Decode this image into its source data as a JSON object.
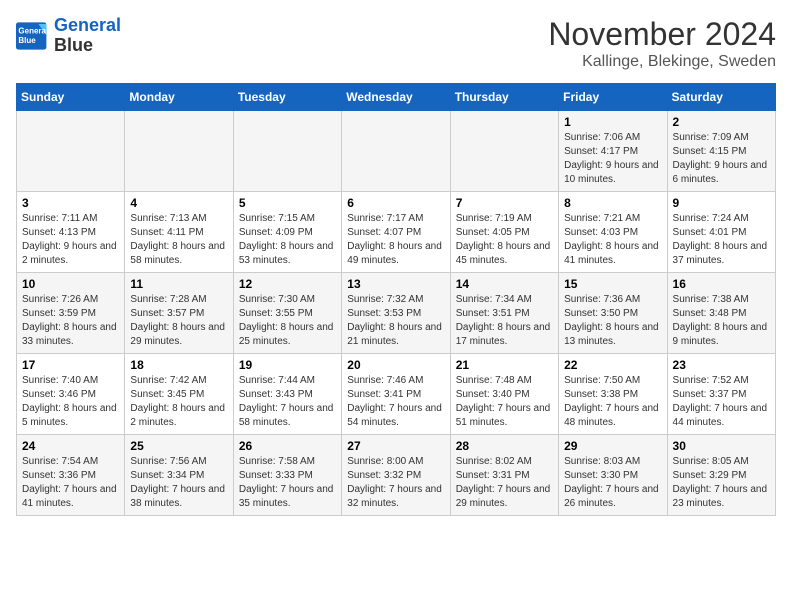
{
  "header": {
    "logo_line1": "General",
    "logo_line2": "Blue",
    "month": "November 2024",
    "location": "Kallinge, Blekinge, Sweden"
  },
  "weekdays": [
    "Sunday",
    "Monday",
    "Tuesday",
    "Wednesday",
    "Thursday",
    "Friday",
    "Saturday"
  ],
  "weeks": [
    [
      {
        "day": "",
        "info": ""
      },
      {
        "day": "",
        "info": ""
      },
      {
        "day": "",
        "info": ""
      },
      {
        "day": "",
        "info": ""
      },
      {
        "day": "",
        "info": ""
      },
      {
        "day": "1",
        "info": "Sunrise: 7:06 AM\nSunset: 4:17 PM\nDaylight: 9 hours and 10 minutes."
      },
      {
        "day": "2",
        "info": "Sunrise: 7:09 AM\nSunset: 4:15 PM\nDaylight: 9 hours and 6 minutes."
      }
    ],
    [
      {
        "day": "3",
        "info": "Sunrise: 7:11 AM\nSunset: 4:13 PM\nDaylight: 9 hours and 2 minutes."
      },
      {
        "day": "4",
        "info": "Sunrise: 7:13 AM\nSunset: 4:11 PM\nDaylight: 8 hours and 58 minutes."
      },
      {
        "day": "5",
        "info": "Sunrise: 7:15 AM\nSunset: 4:09 PM\nDaylight: 8 hours and 53 minutes."
      },
      {
        "day": "6",
        "info": "Sunrise: 7:17 AM\nSunset: 4:07 PM\nDaylight: 8 hours and 49 minutes."
      },
      {
        "day": "7",
        "info": "Sunrise: 7:19 AM\nSunset: 4:05 PM\nDaylight: 8 hours and 45 minutes."
      },
      {
        "day": "8",
        "info": "Sunrise: 7:21 AM\nSunset: 4:03 PM\nDaylight: 8 hours and 41 minutes."
      },
      {
        "day": "9",
        "info": "Sunrise: 7:24 AM\nSunset: 4:01 PM\nDaylight: 8 hours and 37 minutes."
      }
    ],
    [
      {
        "day": "10",
        "info": "Sunrise: 7:26 AM\nSunset: 3:59 PM\nDaylight: 8 hours and 33 minutes."
      },
      {
        "day": "11",
        "info": "Sunrise: 7:28 AM\nSunset: 3:57 PM\nDaylight: 8 hours and 29 minutes."
      },
      {
        "day": "12",
        "info": "Sunrise: 7:30 AM\nSunset: 3:55 PM\nDaylight: 8 hours and 25 minutes."
      },
      {
        "day": "13",
        "info": "Sunrise: 7:32 AM\nSunset: 3:53 PM\nDaylight: 8 hours and 21 minutes."
      },
      {
        "day": "14",
        "info": "Sunrise: 7:34 AM\nSunset: 3:51 PM\nDaylight: 8 hours and 17 minutes."
      },
      {
        "day": "15",
        "info": "Sunrise: 7:36 AM\nSunset: 3:50 PM\nDaylight: 8 hours and 13 minutes."
      },
      {
        "day": "16",
        "info": "Sunrise: 7:38 AM\nSunset: 3:48 PM\nDaylight: 8 hours and 9 minutes."
      }
    ],
    [
      {
        "day": "17",
        "info": "Sunrise: 7:40 AM\nSunset: 3:46 PM\nDaylight: 8 hours and 5 minutes."
      },
      {
        "day": "18",
        "info": "Sunrise: 7:42 AM\nSunset: 3:45 PM\nDaylight: 8 hours and 2 minutes."
      },
      {
        "day": "19",
        "info": "Sunrise: 7:44 AM\nSunset: 3:43 PM\nDaylight: 7 hours and 58 minutes."
      },
      {
        "day": "20",
        "info": "Sunrise: 7:46 AM\nSunset: 3:41 PM\nDaylight: 7 hours and 54 minutes."
      },
      {
        "day": "21",
        "info": "Sunrise: 7:48 AM\nSunset: 3:40 PM\nDaylight: 7 hours and 51 minutes."
      },
      {
        "day": "22",
        "info": "Sunrise: 7:50 AM\nSunset: 3:38 PM\nDaylight: 7 hours and 48 minutes."
      },
      {
        "day": "23",
        "info": "Sunrise: 7:52 AM\nSunset: 3:37 PM\nDaylight: 7 hours and 44 minutes."
      }
    ],
    [
      {
        "day": "24",
        "info": "Sunrise: 7:54 AM\nSunset: 3:36 PM\nDaylight: 7 hours and 41 minutes."
      },
      {
        "day": "25",
        "info": "Sunrise: 7:56 AM\nSunset: 3:34 PM\nDaylight: 7 hours and 38 minutes."
      },
      {
        "day": "26",
        "info": "Sunrise: 7:58 AM\nSunset: 3:33 PM\nDaylight: 7 hours and 35 minutes."
      },
      {
        "day": "27",
        "info": "Sunrise: 8:00 AM\nSunset: 3:32 PM\nDaylight: 7 hours and 32 minutes."
      },
      {
        "day": "28",
        "info": "Sunrise: 8:02 AM\nSunset: 3:31 PM\nDaylight: 7 hours and 29 minutes."
      },
      {
        "day": "29",
        "info": "Sunrise: 8:03 AM\nSunset: 3:30 PM\nDaylight: 7 hours and 26 minutes."
      },
      {
        "day": "30",
        "info": "Sunrise: 8:05 AM\nSunset: 3:29 PM\nDaylight: 7 hours and 23 minutes."
      }
    ]
  ]
}
